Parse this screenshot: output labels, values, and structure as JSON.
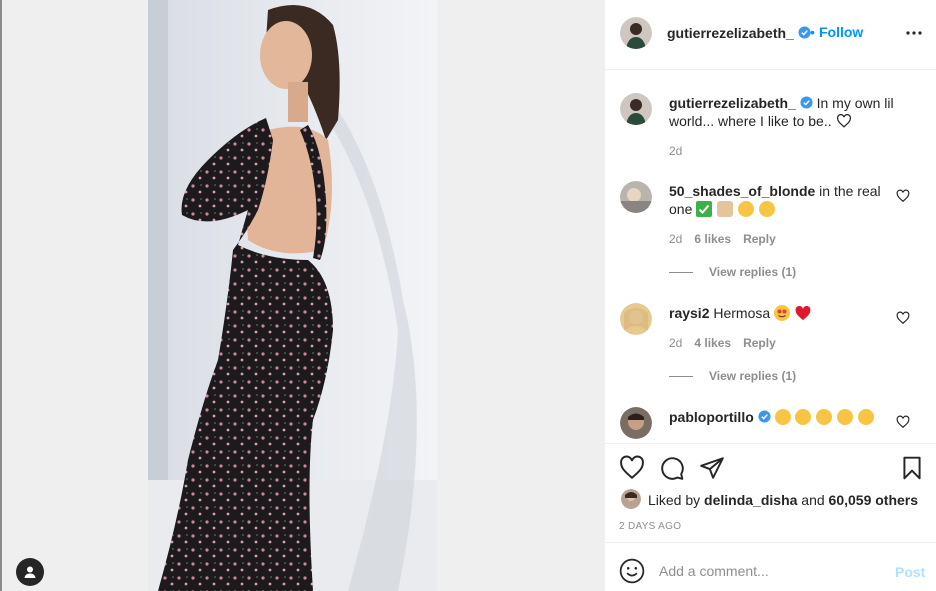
{
  "post": {
    "username": "gutierrezelizabeth_",
    "verified": true,
    "follow_separator": "•",
    "follow_label": "Follow",
    "caption": "In my own lil world... where I like to be..",
    "caption_time": "2d"
  },
  "comments": [
    {
      "username": "50_shades_of_blonde",
      "text": "in the real one",
      "emojis": [
        "check-mark-emoji",
        "hands-emoji",
        "tongue-face-emoji",
        "tongue-face-emoji"
      ],
      "time": "2d",
      "likes": "6 likes",
      "reply_label": "Reply",
      "view_replies": "View replies (1)"
    },
    {
      "username": "raysi2",
      "text": "Hermosa",
      "emojis": [
        "star-eyes-emoji",
        "red-heart-emoji"
      ],
      "time": "2d",
      "likes": "4 likes",
      "reply_label": "Reply",
      "view_replies": "View replies (1)"
    },
    {
      "username": "pabloportillo",
      "verified": true,
      "text": "",
      "emojis": [
        "hugging-face-emoji",
        "hugging-face-emoji",
        "hugging-face-emoji",
        "hugging-face-emoji",
        "hugging-face-emoji"
      ]
    }
  ],
  "likes": {
    "prefix": "Liked by",
    "user": "delinda_disha",
    "joiner": "and",
    "others": "60,059 others"
  },
  "time_ago": "2 DAYS AGO",
  "add_comment": {
    "placeholder": "Add a comment...",
    "post_label": "Post"
  },
  "colors": {
    "accent": "#0095f6",
    "text": "#262626",
    "muted": "#8e8e8e",
    "post_disabled": "#b2dffc",
    "heart_red": "#ed4956"
  }
}
